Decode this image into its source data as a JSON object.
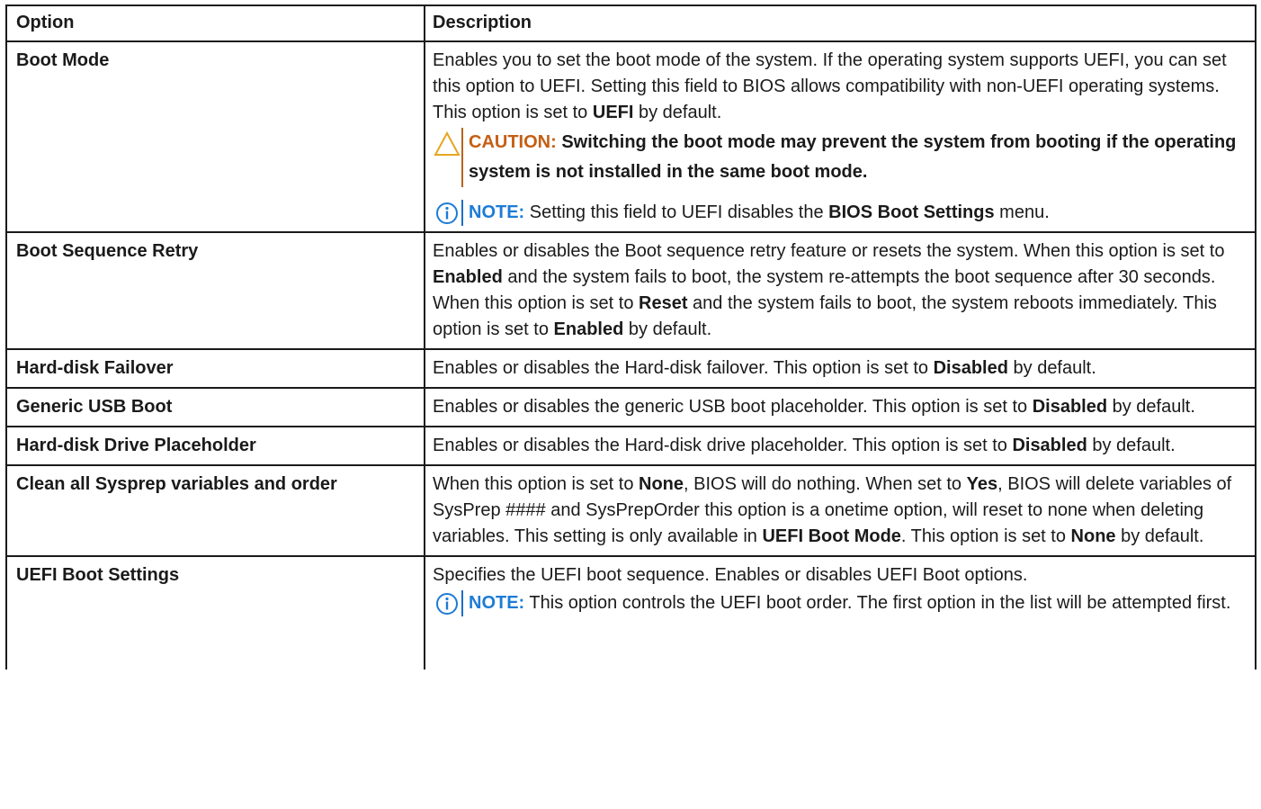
{
  "header": {
    "option": "Option",
    "description": "Description"
  },
  "rows": [
    {
      "option": "Boot Mode",
      "desc_parts": [
        "Enables you to set the boot mode of the system. If the operating system supports UEFI, you can set this option to UEFI. Setting this field to BIOS allows compatibility with non-UEFI operating systems. This option is set to ",
        "UEFI",
        " by default."
      ],
      "caution_label": "CAUTION:",
      "caution_text": " Switching the boot mode may prevent the system from booting if the operating system is not installed in the same boot mode.",
      "note_label": "NOTE:",
      "note_parts": [
        " Setting this field to UEFI disables the ",
        "BIOS Boot Settings",
        " menu."
      ]
    },
    {
      "option": "Boot Sequence Retry",
      "desc_parts": [
        "Enables or disables the Boot sequence retry feature or resets the system. When this option is set to ",
        "Enabled",
        " and the system fails to boot, the system re-attempts the boot sequence after 30 seconds. When this option is set to ",
        "Reset",
        " and the system fails to boot, the system reboots immediately. This option is set to ",
        "Enabled",
        " by default."
      ]
    },
    {
      "option": "Hard-disk Failover",
      "desc_parts": [
        "Enables or disables the Hard-disk failover. This option is set to ",
        "Disabled",
        " by default."
      ]
    },
    {
      "option": "Generic USB Boot",
      "desc_parts": [
        "Enables or disables the generic USB boot placeholder. This option is set to ",
        "Disabled",
        " by default."
      ]
    },
    {
      "option": "Hard-disk Drive Placeholder",
      "desc_parts": [
        "Enables or disables the Hard-disk drive placeholder. This option is set to ",
        "Disabled",
        " by default."
      ]
    },
    {
      "option": "Clean all Sysprep variables and order",
      "desc_parts": [
        "When this option is set to ",
        "None",
        ", BIOS will do nothing. When set to ",
        "Yes",
        ", BIOS will delete variables of SysPrep #### and SysPrepOrder this option is a onetime option, will reset to none when deleting variables. This setting is only available in ",
        "UEFI Boot Mode",
        ". This option is set to ",
        "None",
        " by default."
      ]
    },
    {
      "option": "UEFI Boot Settings",
      "desc_parts": [
        "Specifies the UEFI boot sequence. Enables or disables UEFI Boot options."
      ],
      "note_label": "NOTE:",
      "note_parts": [
        " This option controls the UEFI boot order. The first option in the list will be attempted first."
      ]
    }
  ],
  "icons": {
    "caution": "warning-triangle-icon",
    "note": "info-circle-icon"
  },
  "colors": {
    "caution": "#c45f14",
    "note": "#1d7bd6",
    "border": "#1a1a1a"
  }
}
